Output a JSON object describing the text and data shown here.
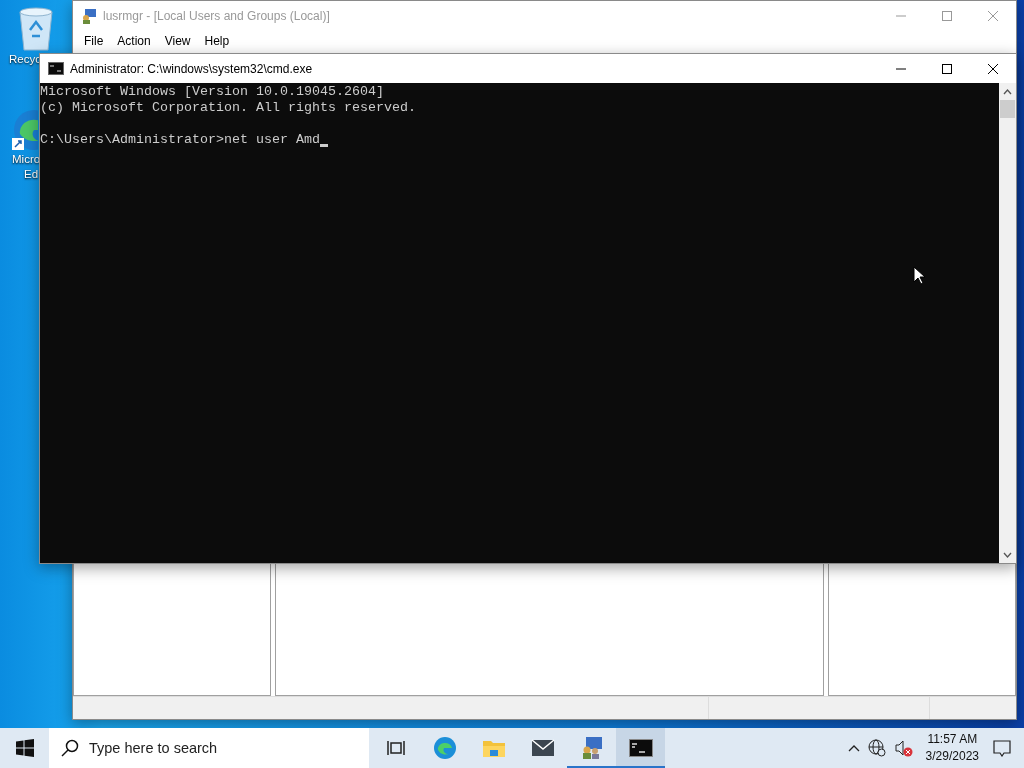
{
  "desktop_icons": [
    {
      "kind": "recycle-bin",
      "lines": [
        "Recyc"
      ]
    },
    {
      "kind": "edge-shortcut",
      "lines": [
        "Micro",
        "Ed"
      ]
    }
  ],
  "background_window": {
    "title": "lusrmgr - [Local Users and Groups (Local)]",
    "menu": [
      "File",
      "Action",
      "View",
      "Help"
    ]
  },
  "console_window": {
    "title": "Administrator: C:\\windows\\system32\\cmd.exe",
    "lines": [
      "Microsoft Windows [Version 10.0.19045.2604]",
      "(c) Microsoft Corporation. All rights reserved."
    ],
    "prompt": "C:\\Users\\Administrator>net user Amd",
    "cursor": true
  },
  "taskbar": {
    "search": {
      "placeholder": "Type here to search"
    },
    "apps": [
      {
        "kind": "task-view",
        "running": false,
        "selected": false
      },
      {
        "kind": "edge",
        "running": false,
        "selected": false
      },
      {
        "kind": "folder",
        "running": false,
        "selected": false
      },
      {
        "kind": "mail",
        "running": false,
        "selected": false
      },
      {
        "kind": "users",
        "running": true,
        "selected": false
      },
      {
        "kind": "console",
        "running": true,
        "selected": true
      }
    ],
    "time": "11:57 AM",
    "date": "3/29/2023"
  }
}
